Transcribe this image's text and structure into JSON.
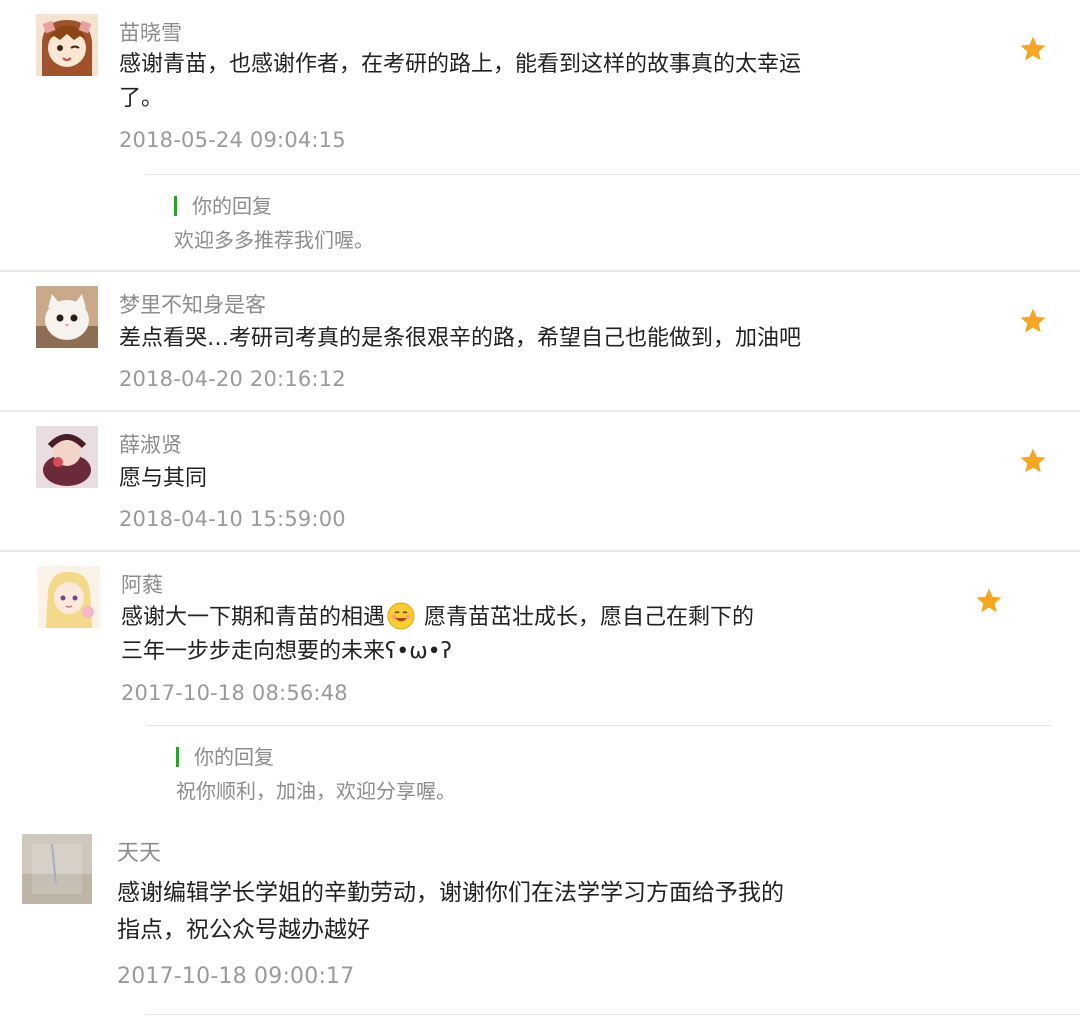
{
  "comments": [
    {
      "nickname": "苗晓雪",
      "text_line1": "感谢青苗，也感谢作者，在考研的路上，能看到这样的故事真的太幸运",
      "text_line2": "了。",
      "time": "2018-05-24 09:04:15",
      "reply": {
        "label": "你的回复",
        "text": "欢迎多多推荐我们喔。"
      }
    },
    {
      "nickname": "梦里不知身是客",
      "text_line1": "差点看哭…考研司考真的是条很艰辛的路，希望自己也能做到，加油吧",
      "time": "2018-04-20 20:16:12"
    },
    {
      "nickname": "薛淑贤",
      "text_line1": "愿与其同",
      "time": "2018-04-10 15:59:00"
    },
    {
      "nickname": "阿蕤",
      "text_line1_a": "感谢大一下期和青苗的相遇",
      "text_line1_b": "愿青苗茁壮成长，愿自己在剩下的",
      "text_line2": "三年一步步走向想要的未来ʕ•ω•ʔ",
      "time": "2017-10-18 08:56:48",
      "reply": {
        "label": "你的回复",
        "text": "祝你顺利，加油，欢迎分享喔。"
      }
    },
    {
      "nickname": "天天",
      "text_line1": "感谢编辑学长学姐的辛勤劳动，谢谢你们在法学学习方面给予我的",
      "text_line2": "指点，祝公众号越办越好",
      "time": "2017-10-18 09:00:17"
    }
  ],
  "icons": {
    "star": "star-icon",
    "emoji": "smiling-face-emoji"
  },
  "colors": {
    "star": "#f5a623",
    "reply_bar": "#1aad19",
    "nickname": "#8c8c8c",
    "time": "#9a9a9a"
  }
}
